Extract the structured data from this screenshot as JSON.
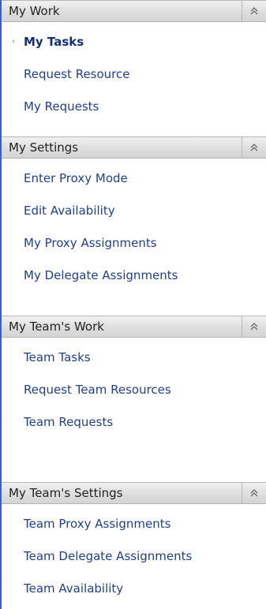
{
  "sections": [
    {
      "title": "My Work",
      "items": [
        {
          "label": "My Tasks",
          "active": true
        },
        {
          "label": "Request Resource"
        },
        {
          "label": "My Requests"
        }
      ]
    },
    {
      "title": "My Settings",
      "items": [
        {
          "label": "Enter Proxy Mode"
        },
        {
          "label": "Edit Availability"
        },
        {
          "label": "My Proxy Assignments"
        },
        {
          "label": "My Delegate Assignments"
        }
      ]
    },
    {
      "title": "My Team's Work",
      "items": [
        {
          "label": "Team Tasks"
        },
        {
          "label": "Request Team Resources"
        },
        {
          "label": "Team Requests"
        }
      ]
    },
    {
      "title": "My Team's Settings",
      "items": [
        {
          "label": "Team Proxy Assignments"
        },
        {
          "label": "Team Delegate Assignments"
        },
        {
          "label": "Team Availability"
        }
      ]
    }
  ],
  "icons": {
    "collapse": "double-chevron-up-icon",
    "active_marker": "bullet-icon"
  },
  "colors": {
    "link": "#1e3f8f",
    "active_link": "#15307a",
    "header_bg": "#dedede",
    "left_border": "#3a5fc8"
  }
}
